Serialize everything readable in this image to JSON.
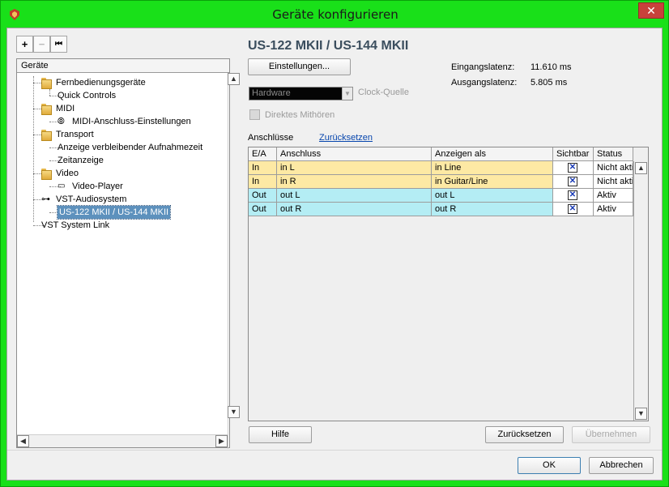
{
  "window": {
    "title": "Geräte konfigurieren",
    "close_label": "✕"
  },
  "toolbar": {
    "add_label": "+",
    "remove_label": "−",
    "reset_label": "⏮"
  },
  "tree": {
    "header": "Geräte",
    "items": [
      {
        "label": "Fernbedienungsgeräte",
        "type": "folder"
      },
      {
        "label": "Quick Controls",
        "type": "leaf"
      },
      {
        "label": "MIDI",
        "type": "folder"
      },
      {
        "label": "MIDI-Anschluss-Einstellungen",
        "type": "midi"
      },
      {
        "label": "Transport",
        "type": "folder"
      },
      {
        "label": "Anzeige verbleibender Aufnahmezeit",
        "type": "leaf"
      },
      {
        "label": "Zeitanzeige",
        "type": "leaf"
      },
      {
        "label": "Video",
        "type": "folder"
      },
      {
        "label": "Video-Player",
        "type": "video"
      },
      {
        "label": "VST-Audiosystem",
        "type": "audio"
      },
      {
        "label": "US-122 MKII / US-144 MKII",
        "type": "selected"
      },
      {
        "label": "VST System Link",
        "type": "root"
      }
    ]
  },
  "device": {
    "title": "US-122 MKII / US-144 MKII",
    "settings_button": "Einstellungen...",
    "input_latency_label": "Eingangslatenz:",
    "input_latency_value": "11.610 ms",
    "output_latency_label": "Ausgangslatenz:",
    "output_latency_value": "5.805 ms",
    "clock_source_value": "Hardware",
    "clock_source_label": "Clock-Quelle",
    "direct_monitoring_label": "Direktes Mithören",
    "ports_label": "Anschlüsse",
    "reset_link": "Zurücksetzen"
  },
  "ports_table": {
    "columns": [
      "E/A",
      "Anschluss",
      "Anzeigen als",
      "Sichtbar",
      "Status"
    ],
    "rows": [
      {
        "io": "In",
        "port": "in L",
        "show_as": "in Line",
        "visible": "✕",
        "status": "Nicht aktiv",
        "color": "#fde9a4"
      },
      {
        "io": "In",
        "port": "in R",
        "show_as": "in Guitar/Line",
        "visible": "✕",
        "status": "Nicht aktiv",
        "color": "#fde9a4"
      },
      {
        "io": "Out",
        "port": "out L",
        "show_as": "out L",
        "visible": "✕",
        "status": "Aktiv",
        "color": "#b4edf4"
      },
      {
        "io": "Out",
        "port": "out R",
        "show_as": "out R",
        "visible": "✕",
        "status": "Aktiv",
        "color": "#b4edf4"
      }
    ]
  },
  "buttons": {
    "help": "Hilfe",
    "reset": "Zurücksetzen",
    "apply": "Übernehmen",
    "ok": "OK",
    "cancel": "Abbrechen"
  }
}
